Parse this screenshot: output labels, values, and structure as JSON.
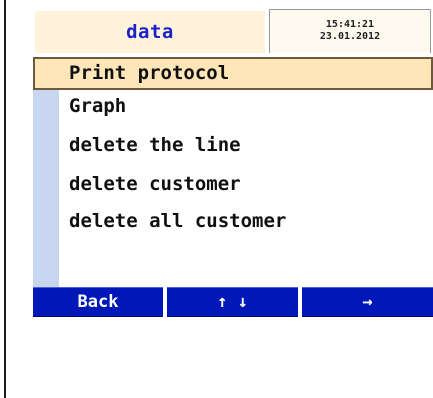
{
  "header": {
    "title": "data",
    "time": "15:41:21",
    "date": "23.01.2012"
  },
  "menu": {
    "items": [
      {
        "label": "Print protocol",
        "selected": true
      },
      {
        "label": "Graph"
      },
      {
        "label": "delete the line"
      },
      {
        "label": "delete customer"
      },
      {
        "label": "delete all customer"
      }
    ]
  },
  "softkeys": {
    "back": "Back",
    "updown": "↑ ↓",
    "next": "→"
  },
  "colors": {
    "accent": "#0018b8",
    "selection": "#ffe6b8",
    "title_text": "#1a22c8"
  }
}
